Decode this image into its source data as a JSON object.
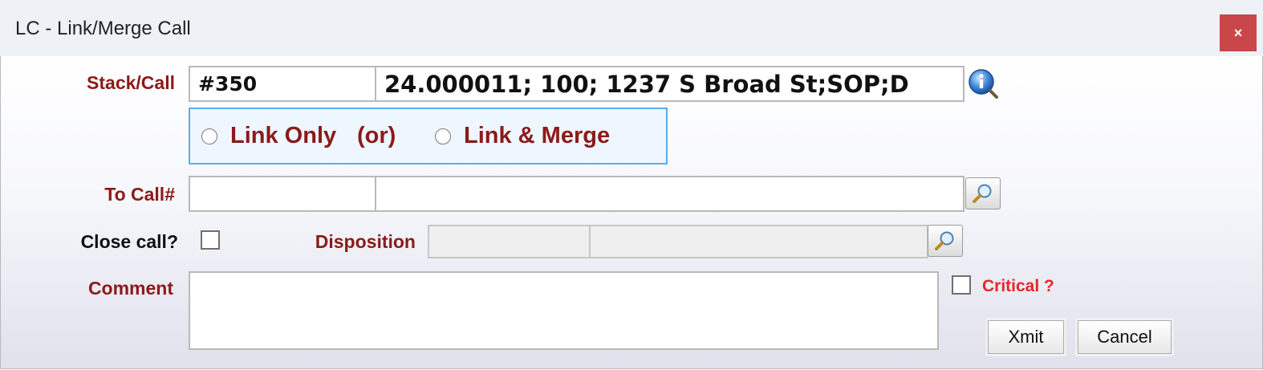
{
  "window": {
    "title": "LC - Link/Merge Call",
    "close_label": "×"
  },
  "stack_call": {
    "label": "Stack/Call",
    "number": "#350",
    "description": "24.000011; 100; 1237 S Broad St;SOP;D",
    "info_icon": "info-icon"
  },
  "mode": {
    "options": [
      {
        "label": "Link Only",
        "selected": false
      },
      {
        "label": "Link & Merge",
        "selected": false
      }
    ],
    "separator": "(or)"
  },
  "to_call": {
    "label": "To Call#",
    "number": "",
    "description": "",
    "lookup_icon": "magnifier-icon"
  },
  "close_call": {
    "label": "Close call?",
    "checked": false
  },
  "disposition": {
    "label": "Disposition",
    "code": "",
    "description": "",
    "lookup_icon": "magnifier-icon"
  },
  "comment": {
    "label": "Comment",
    "value": ""
  },
  "critical": {
    "label": "Critical ?",
    "checked": false
  },
  "buttons": {
    "xmit": "Xmit",
    "cancel": "Cancel"
  }
}
